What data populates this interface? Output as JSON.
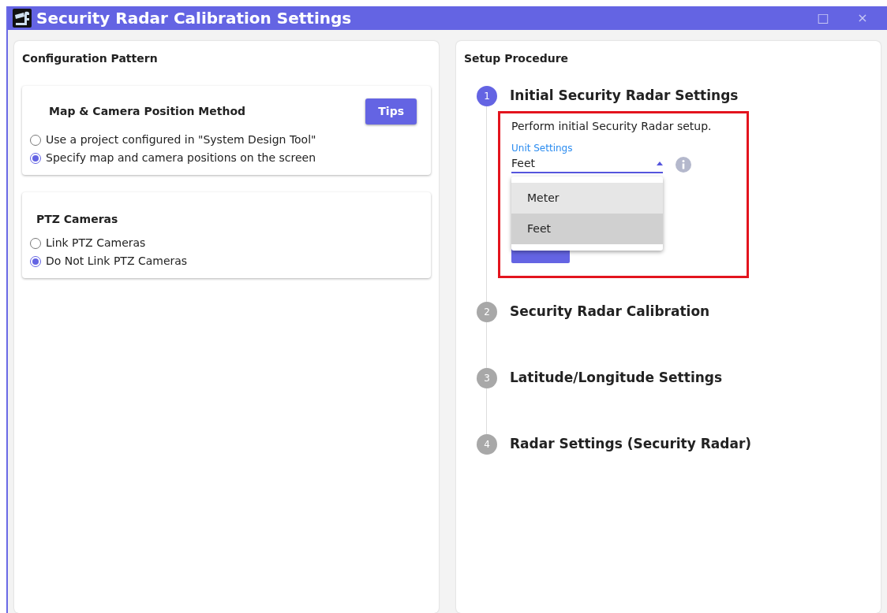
{
  "window": {
    "title": "Security Radar Calibration Settings",
    "controls": [
      "□",
      "×"
    ]
  },
  "configuration": {
    "heading": "Configuration Pattern",
    "groups": [
      {
        "title": "Map & Camera Position Method",
        "tips_button": "Tips",
        "options": [
          {
            "label": "Use a project configured in \"System Design Tool\"",
            "selected": false
          },
          {
            "label": "Specify map and camera positions on the screen",
            "selected": true
          }
        ]
      },
      {
        "title": "PTZ Cameras",
        "options": [
          {
            "label": "Link PTZ Cameras",
            "selected": false
          },
          {
            "label": "Do Not Link PTZ Cameras",
            "selected": true
          }
        ]
      }
    ]
  },
  "setup": {
    "heading": "Setup Procedure",
    "steps": [
      {
        "number": "1",
        "title": "Initial Security Radar Settings",
        "active": true,
        "description": "Perform initial Security Radar setup.",
        "unit_field": {
          "label": "Unit Settings",
          "value": "Feet",
          "options": [
            {
              "label": "Meter",
              "selected": false
            },
            {
              "label": "Feet",
              "selected": true
            }
          ]
        }
      },
      {
        "number": "2",
        "title": "Security Radar Calibration",
        "active": false
      },
      {
        "number": "3",
        "title": "Latitude/Longitude Settings",
        "active": false
      },
      {
        "number": "4",
        "title": "Radar Settings (Security Radar)",
        "active": false
      }
    ]
  }
}
